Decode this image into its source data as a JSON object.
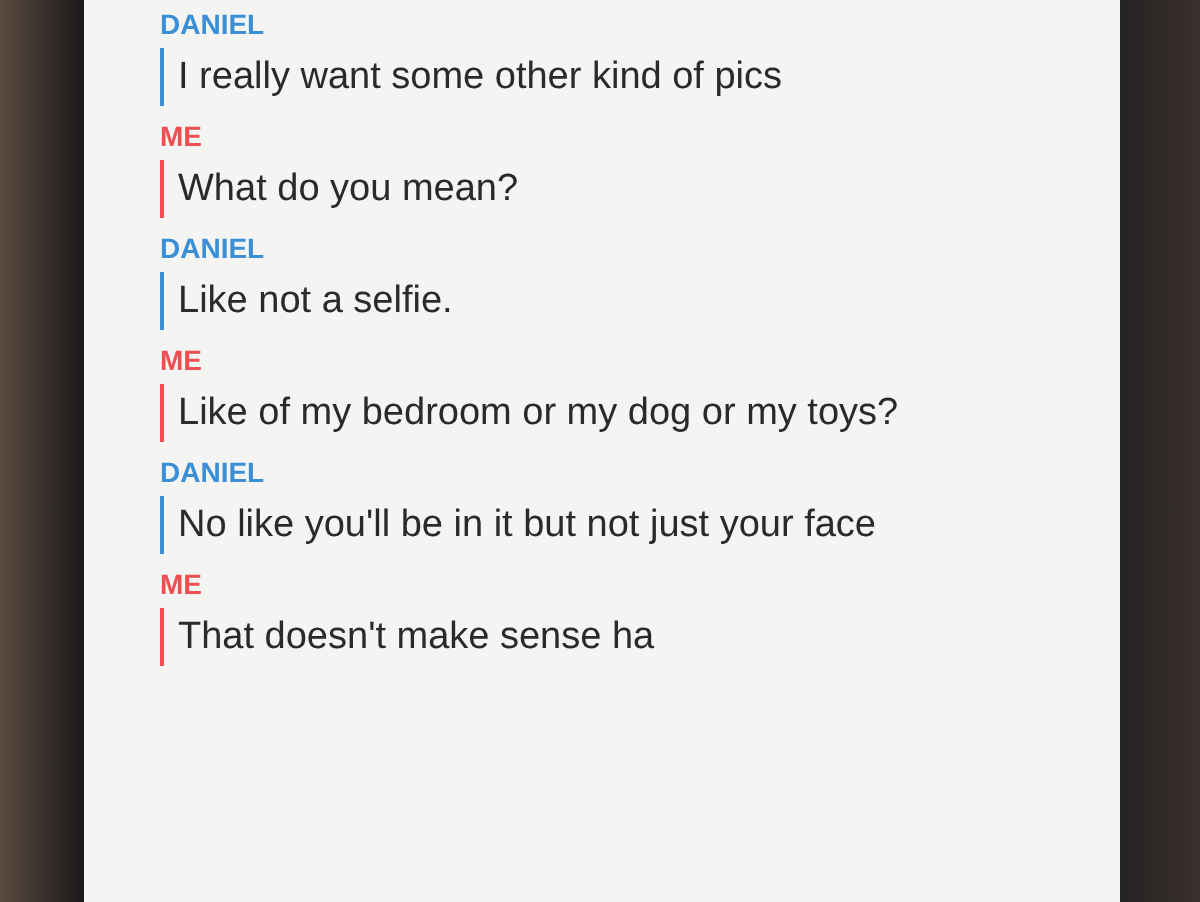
{
  "messages": [
    {
      "sender": "DANIEL",
      "color": "#3b8fd6",
      "text": "I really want some other kind of pics"
    },
    {
      "sender": "ME",
      "color": "#ef4f50",
      "text": "What do you mean?"
    },
    {
      "sender": "DANIEL",
      "color": "#3b8fd6",
      "text": "Like not a selfie."
    },
    {
      "sender": "ME",
      "color": "#ef4f50",
      "text": "Like of my bedroom or my dog or my toys?"
    },
    {
      "sender": "DANIEL",
      "color": "#3b8fd6",
      "text": "No like you'll be in it but not just your face"
    },
    {
      "sender": "ME",
      "color": "#ef4f50",
      "text": "That doesn't make sense ha"
    }
  ]
}
